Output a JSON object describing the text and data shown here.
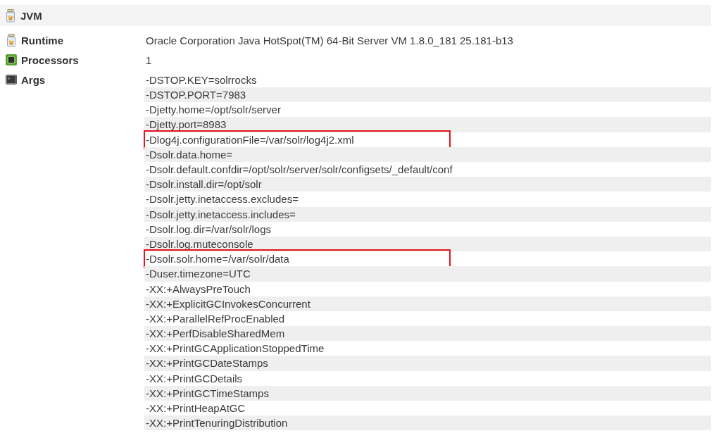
{
  "section": {
    "title": "JVM"
  },
  "properties": [
    {
      "label": "Runtime",
      "values": [
        {
          "text": "Oracle Corporation Java HotSpot(TM) 64-Bit Server VM 1.8.0_181 25.181-b13",
          "highlighted": false
        }
      ]
    },
    {
      "label": "Processors",
      "values": [
        {
          "text": "1",
          "highlighted": false
        }
      ]
    },
    {
      "label": "Args",
      "values": [
        {
          "text": "-DSTOP.KEY=solrrocks",
          "highlighted": false
        },
        {
          "text": "-DSTOP.PORT=7983",
          "highlighted": false
        },
        {
          "text": "-Djetty.home=/opt/solr/server",
          "highlighted": false
        },
        {
          "text": "-Djetty.port=8983",
          "highlighted": false
        },
        {
          "text": "-Dlog4j.configurationFile=/var/solr/log4j2.xml",
          "highlighted": true
        },
        {
          "text": "-Dsolr.data.home=",
          "highlighted": false
        },
        {
          "text": "-Dsolr.default.confdir=/opt/solr/server/solr/configsets/_default/conf",
          "highlighted": false
        },
        {
          "text": "-Dsolr.install.dir=/opt/solr",
          "highlighted": false
        },
        {
          "text": "-Dsolr.jetty.inetaccess.excludes=",
          "highlighted": false
        },
        {
          "text": "-Dsolr.jetty.inetaccess.includes=",
          "highlighted": false
        },
        {
          "text": "-Dsolr.log.dir=/var/solr/logs",
          "highlighted": false
        },
        {
          "text": "-Dsolr.log.muteconsole",
          "highlighted": false
        },
        {
          "text": "-Dsolr.solr.home=/var/solr/data",
          "highlighted": true
        },
        {
          "text": "-Duser.timezone=UTC",
          "highlighted": false
        },
        {
          "text": "-XX:+AlwaysPreTouch",
          "highlighted": false
        },
        {
          "text": "-XX:+ExplicitGCInvokesConcurrent",
          "highlighted": false
        },
        {
          "text": "-XX:+ParallelRefProcEnabled",
          "highlighted": false
        },
        {
          "text": "-XX:+PerfDisableSharedMem",
          "highlighted": false
        },
        {
          "text": "-XX:+PrintGCApplicationStoppedTime",
          "highlighted": false
        },
        {
          "text": "-XX:+PrintGCDateStamps",
          "highlighted": false
        },
        {
          "text": "-XX:+PrintGCDetails",
          "highlighted": false
        },
        {
          "text": "-XX:+PrintGCTimeStamps",
          "highlighted": false
        },
        {
          "text": "-XX:+PrintHeapAtGC",
          "highlighted": false
        },
        {
          "text": "-XX:+PrintTenuringDistribution",
          "highlighted": false
        }
      ]
    }
  ]
}
